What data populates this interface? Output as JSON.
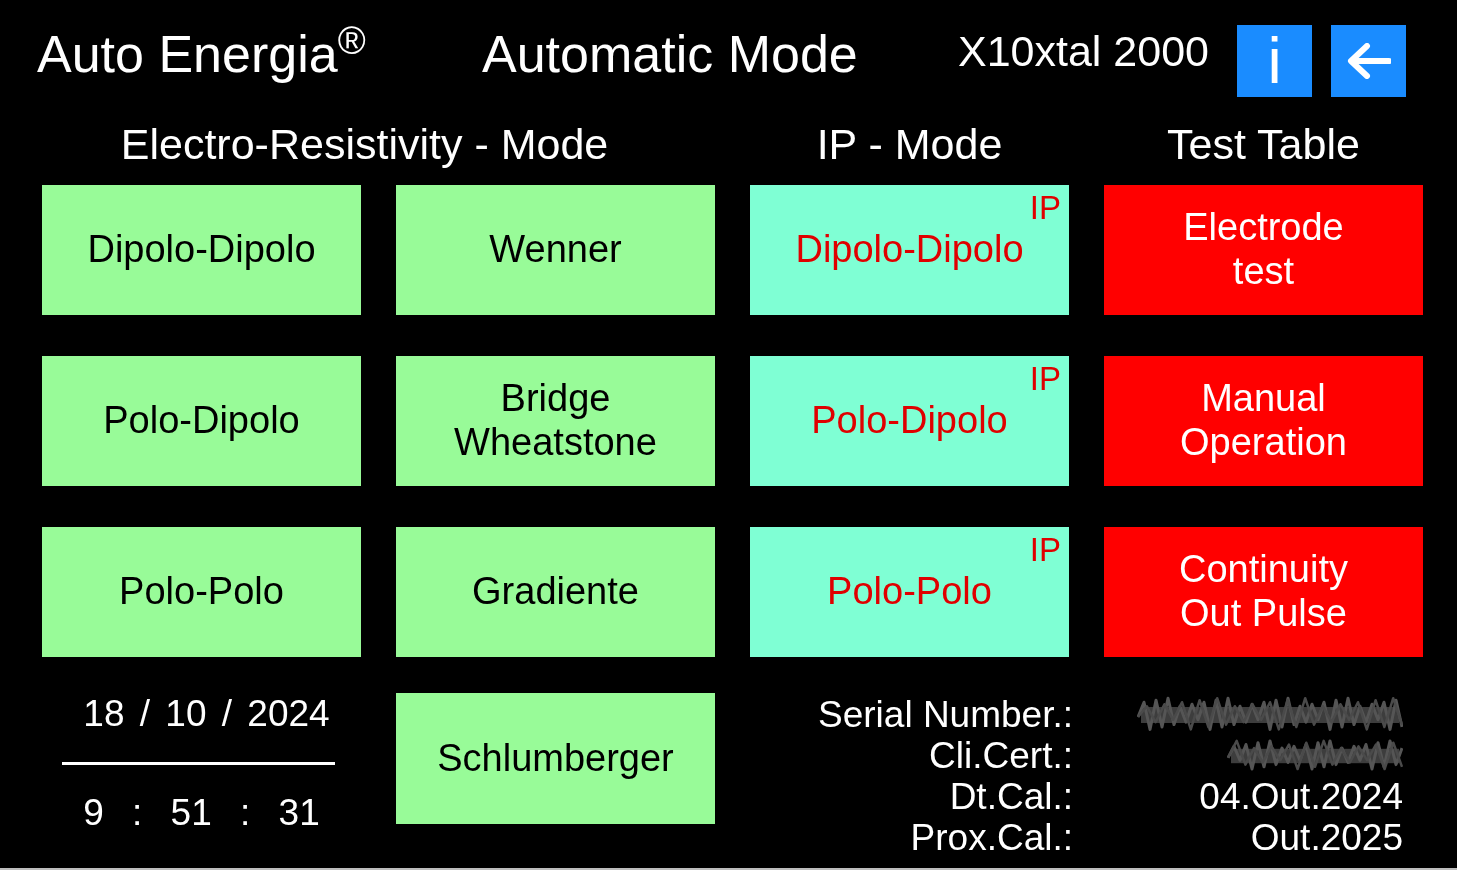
{
  "header": {
    "brand": "Auto Energia$^{®}$",
    "mode": "Automatic Mode",
    "device": "X10xtal 2000",
    "buttons": [
      {
        "kind": "info",
        "label": "i"
      },
      {
        "kind": "back"
      }
    ]
  },
  "column_headings": [
    {
      "kind": "resistivity",
      "label": "Electro-Resistivity - Mode"
    },
    {
      "kind": "ip",
      "label": "IP - Mode"
    },
    {
      "kind": "test",
      "label": "Test Table"
    }
  ],
  "button_rows": [
    [
      {
        "kind": "resistivity",
        "label": "Dipolo-Dipolo"
      },
      {
        "kind": "resistivity",
        "label": "Wenner"
      },
      {
        "kind": "ip",
        "label": "Dipolo-Dipolo",
        "tag": "IP"
      },
      {
        "kind": "test",
        "label": "Electrode\ntest"
      }
    ],
    [
      {
        "kind": "resistivity",
        "label": "Polo-Dipolo"
      },
      {
        "kind": "resistivity",
        "label": "Bridge\nWheatstone"
      },
      {
        "kind": "ip",
        "label": "Polo-Dipolo",
        "tag": "IP"
      },
      {
        "kind": "test",
        "label": "Manual\nOperation"
      }
    ],
    [
      {
        "kind": "resistivity",
        "label": "Polo-Polo"
      },
      {
        "kind": "resistivity",
        "label": "Gradiente"
      },
      {
        "kind": "ip",
        "label": "Polo-Polo",
        "tag": "IP"
      },
      {
        "kind": "test",
        "label": "Continuity\nOut Pulse"
      }
    ]
  ],
  "footer": {
    "date": "18 / 10 / 2024",
    "time": "9 : 51 : 31",
    "button": {
      "kind": "resistivity",
      "label": "Schlumberger"
    },
    "calibration": [
      {
        "kind": "redacted",
        "label": "Serial Number.:"
      },
      {
        "kind": "redacted",
        "label": "Cli.Cert.:"
      },
      {
        "kind": "text",
        "label": "Dt.Cal.:",
        "value": "04.Out.2024"
      },
      {
        "kind": "text",
        "label": "Prox.Cal.:",
        "value": "Out.2025"
      }
    ]
  }
}
